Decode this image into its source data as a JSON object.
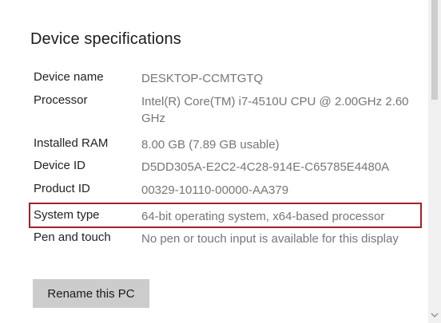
{
  "section": {
    "title": "Device specifications"
  },
  "specs": [
    {
      "label": "Device name",
      "value": "DESKTOP-CCMTGTQ"
    },
    {
      "label": "Processor",
      "value": "Intel(R) Core(TM) i7-4510U CPU @ 2.00GHz 2.60 GHz"
    },
    {
      "label": "Installed RAM",
      "value": "8.00 GB (7.89 GB usable)"
    },
    {
      "label": "Device ID",
      "value": "D5DD305A-E2C2-4C28-914E-C65785E4480A"
    },
    {
      "label": "Product ID",
      "value": "00329-10110-00000-AA379"
    },
    {
      "label": "System type",
      "value": "64-bit operating system, x64-based processor"
    },
    {
      "label": "Pen and touch",
      "value": "No pen or touch input is available for this display"
    }
  ],
  "actions": {
    "rename_label": "Rename this PC"
  },
  "highlight": {
    "color": "#a3202b"
  },
  "icons": {
    "scroll_down": "chevron-down-icon"
  }
}
